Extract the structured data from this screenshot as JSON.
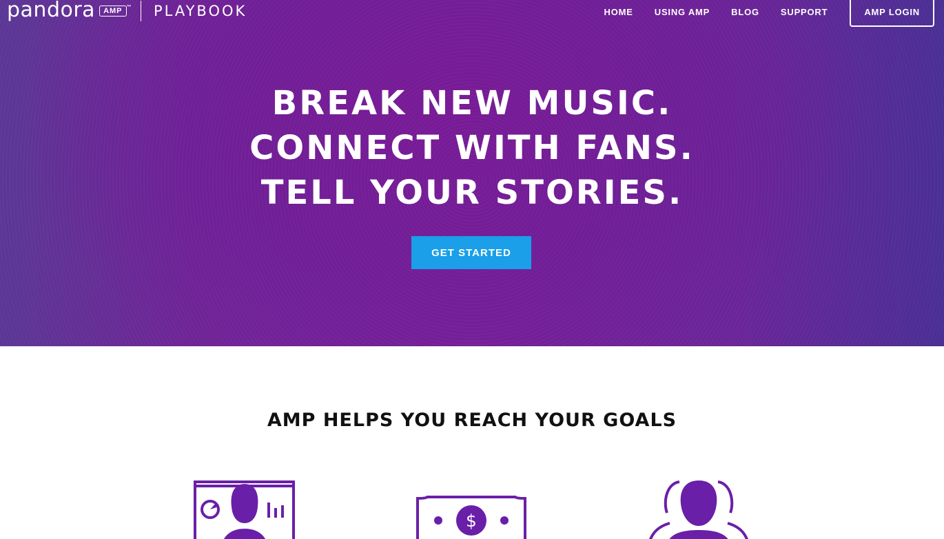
{
  "header": {
    "brand": "pandora",
    "brand_badge": "AMP",
    "brand_tm": "™",
    "brand_product": "PLAYBOOK",
    "nav": [
      {
        "label": "HOME"
      },
      {
        "label": "USING AMP"
      },
      {
        "label": "BLOG"
      },
      {
        "label": "SUPPORT"
      }
    ],
    "login_label": "AMP LOGIN"
  },
  "hero": {
    "lines": [
      "BREAK NEW MUSIC.",
      "CONNECT WITH FANS.",
      "TELL YOUR STORIES."
    ],
    "cta_label": "GET STARTED"
  },
  "goals": {
    "title": "AMP HELPS YOU REACH YOUR GOALS",
    "icons": [
      "artist-dashboard-icon",
      "money-bill-icon",
      "fans-icon"
    ]
  },
  "colors": {
    "accent": "#1a9fe8",
    "icon_purple": "#6a1fa8",
    "hero_purple": "#78209a"
  },
  "symbols": {
    "dollar": "$"
  }
}
